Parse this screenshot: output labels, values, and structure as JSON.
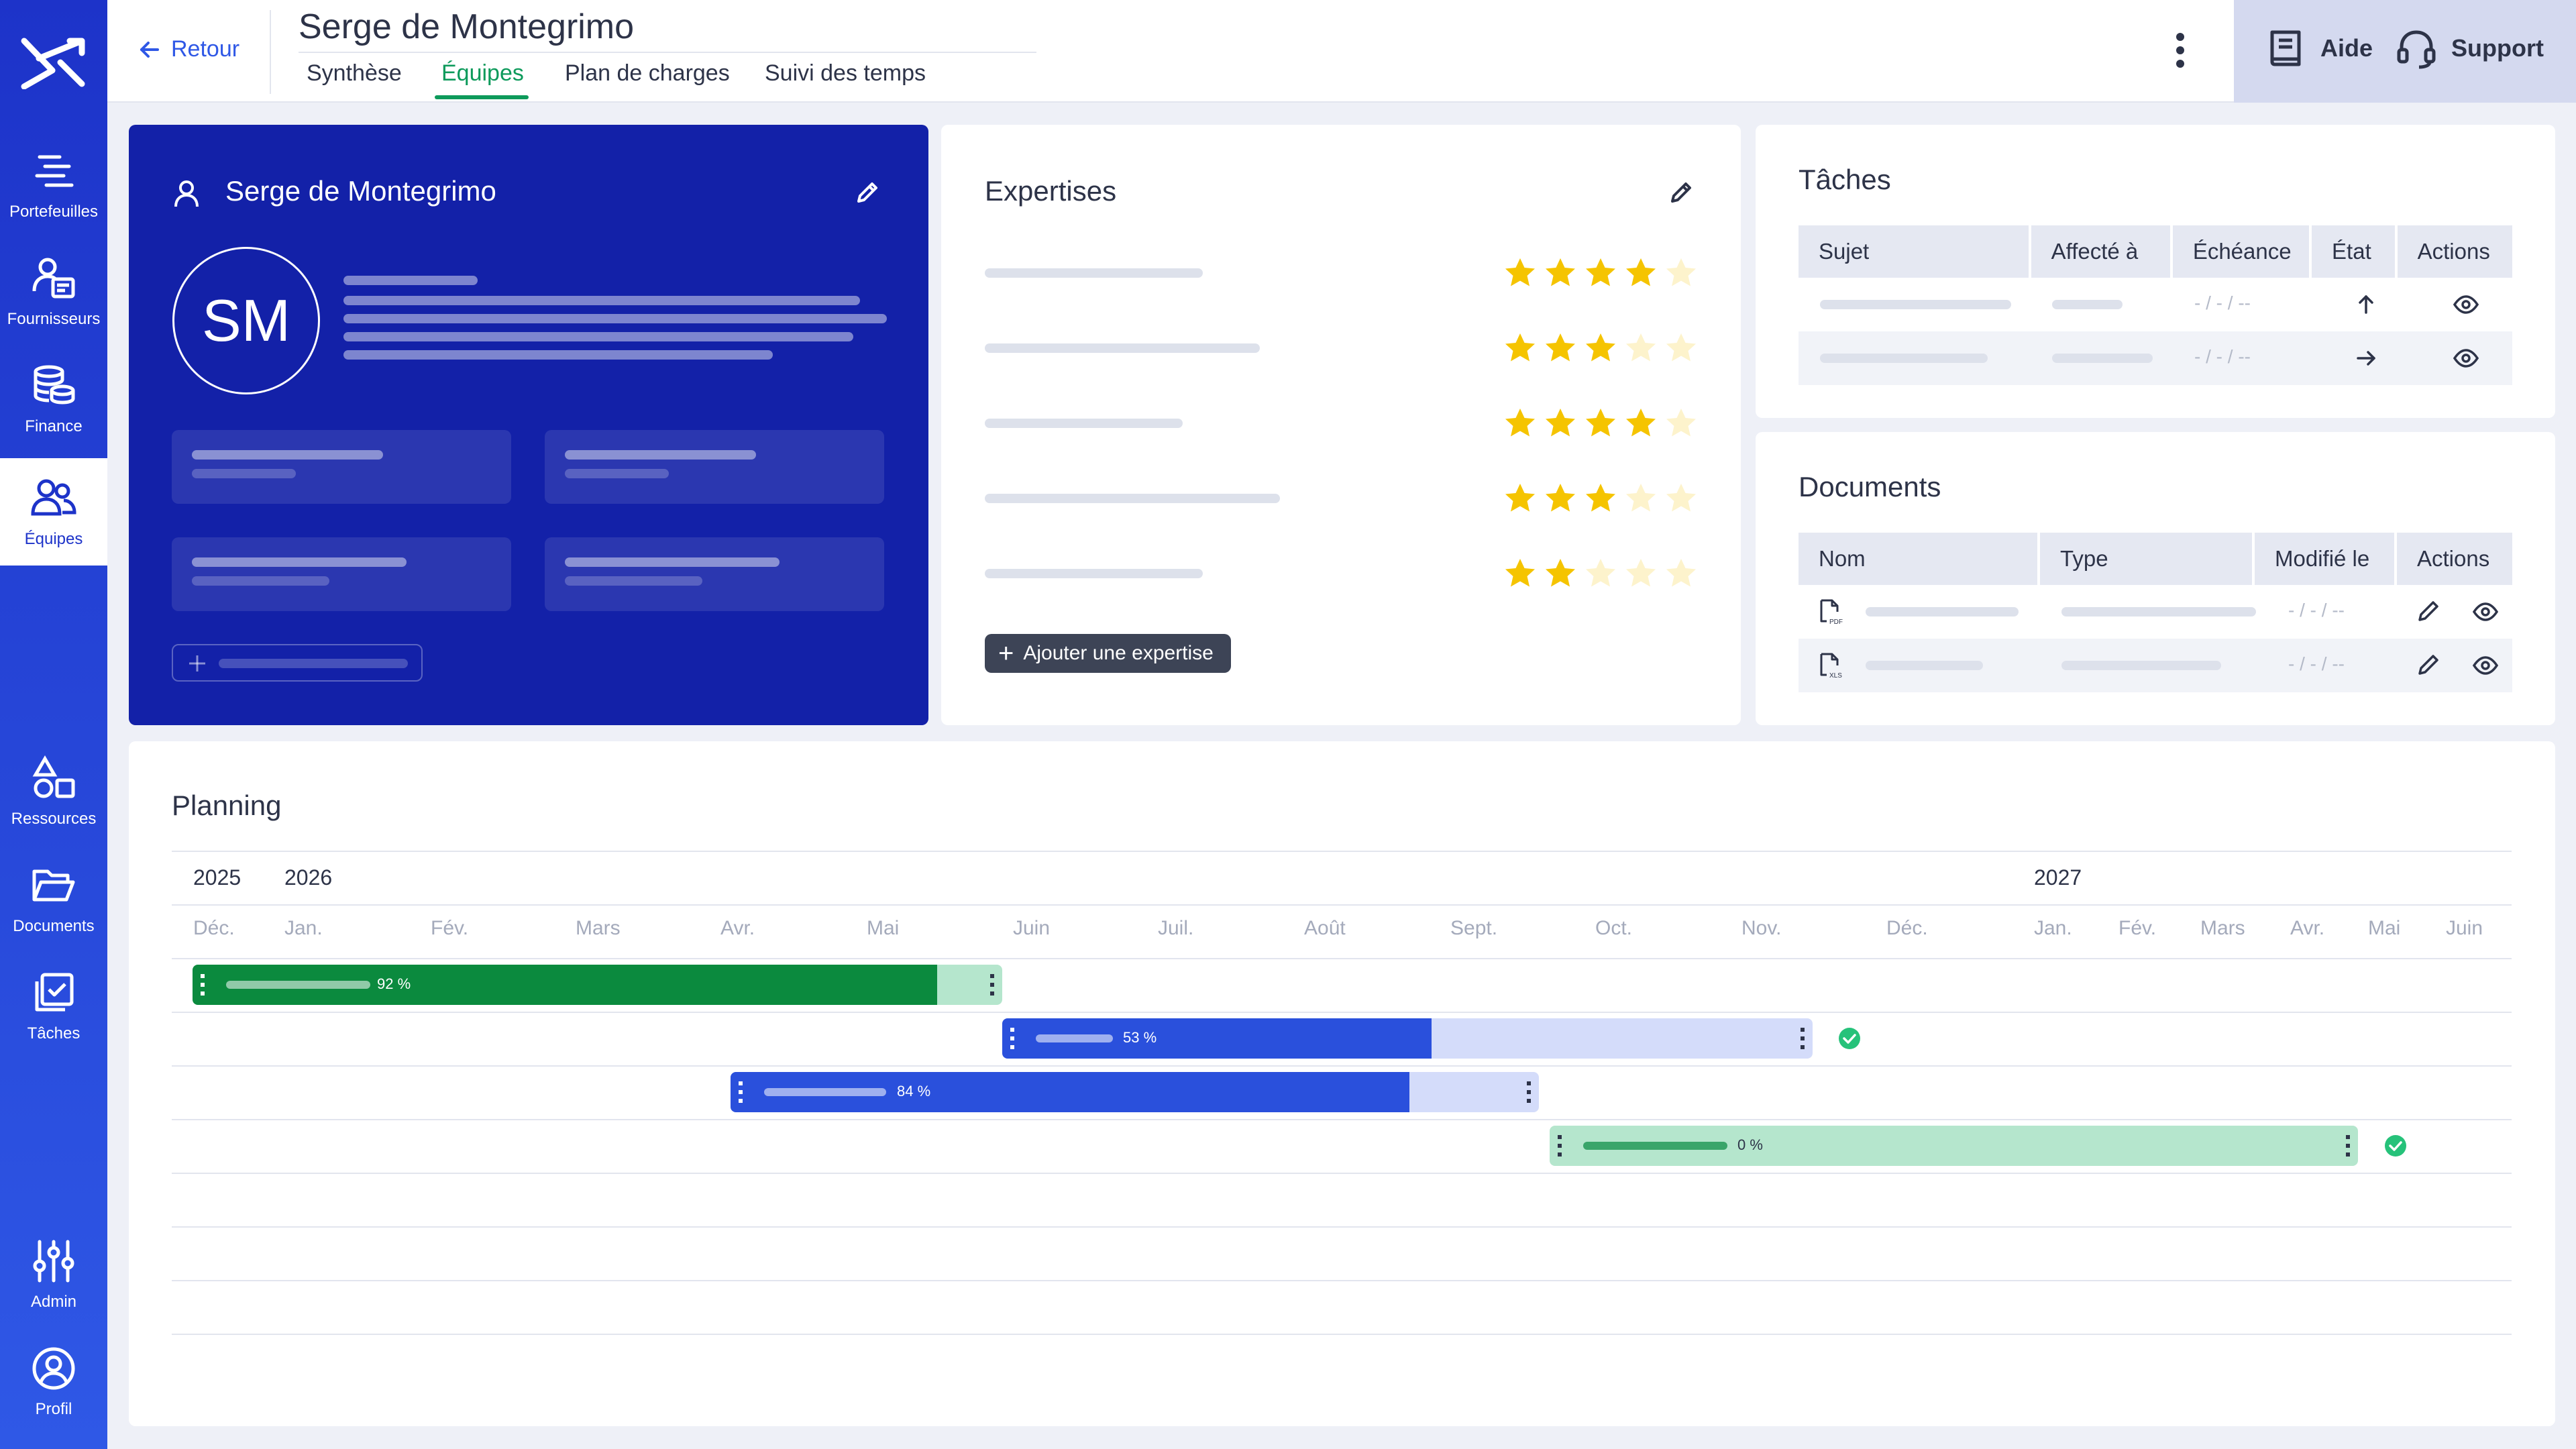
{
  "nav": {
    "items": [
      {
        "label": "Portefeuilles",
        "icon": "portfolio-icon"
      },
      {
        "label": "Fournisseurs",
        "icon": "suppliers-icon"
      },
      {
        "label": "Finance",
        "icon": "finance-icon"
      },
      {
        "label": "Équipes",
        "icon": "team-icon",
        "active": true
      },
      {
        "label": "Ressources",
        "icon": "resources-icon"
      },
      {
        "label": "Documents",
        "icon": "folder-icon"
      },
      {
        "label": "Tâches",
        "icon": "tasks-icon"
      },
      {
        "label": "Admin",
        "icon": "sliders-icon"
      },
      {
        "label": "Profil",
        "icon": "profile-icon"
      }
    ]
  },
  "header": {
    "back_label": "Retour",
    "title": "Serge de Montegrimo",
    "tabs": [
      {
        "label": "Synthèse"
      },
      {
        "label": "Équipes",
        "active": true
      },
      {
        "label": "Plan de charges"
      },
      {
        "label": "Suivi des temps"
      }
    ],
    "help_label": "Aide",
    "support_label": "Support"
  },
  "profile": {
    "name": "Serge de Montegrimo",
    "initials": "SM"
  },
  "expertises": {
    "title": "Expertises",
    "ratings": [
      4,
      3,
      4,
      3,
      2
    ],
    "max_rating": 5,
    "add_label": "Ajouter une expertise"
  },
  "tasks": {
    "title": "Tâches",
    "columns": [
      "Sujet",
      "Affecté à",
      "Échéance",
      "État",
      "Actions"
    ],
    "rows": [
      {
        "due": "- / - / --",
        "state_icon": "arrow-up-icon"
      },
      {
        "due": "- / - / --",
        "state_icon": "arrow-right-icon"
      }
    ]
  },
  "documents": {
    "title": "Documents",
    "columns": [
      "Nom",
      "Type",
      "Modifié le",
      "Actions"
    ],
    "rows": [
      {
        "file_icon": "pdf-file-icon",
        "modified": "- / - / --"
      },
      {
        "file_icon": "xls-file-icon",
        "modified": "- / - / --"
      }
    ]
  },
  "planning": {
    "title": "Planning",
    "years": [
      "2025",
      "2026",
      "2027"
    ],
    "months": [
      "Déc.",
      "Jan.",
      "Fév.",
      "Mars",
      "Avr.",
      "Mai",
      "Juin",
      "Juil.",
      "Août",
      "Sept.",
      "Oct.",
      "Nov.",
      "Déc.",
      "Jan.",
      "Fév.",
      "Mars",
      "Avr.",
      "Mai",
      "Juin"
    ],
    "bars": [
      {
        "progress": "92 %",
        "progress_value": 0.92,
        "color": "#0b8a3e",
        "done": false
      },
      {
        "progress": "53 %",
        "progress_value": 0.53,
        "color": "#2a50dc",
        "done": true
      },
      {
        "progress": "84 %",
        "progress_value": 0.84,
        "color": "#2a50dc",
        "done": false
      },
      {
        "progress": "0 %",
        "progress_value": 0.0,
        "color": "#3aa56a",
        "done": true
      }
    ]
  },
  "colors": {
    "sidebar": "#1d33c9",
    "accent": "#2f58e6",
    "success": "#0d9a5b",
    "profile_card": "#1321a8",
    "star": "#f5c400"
  }
}
